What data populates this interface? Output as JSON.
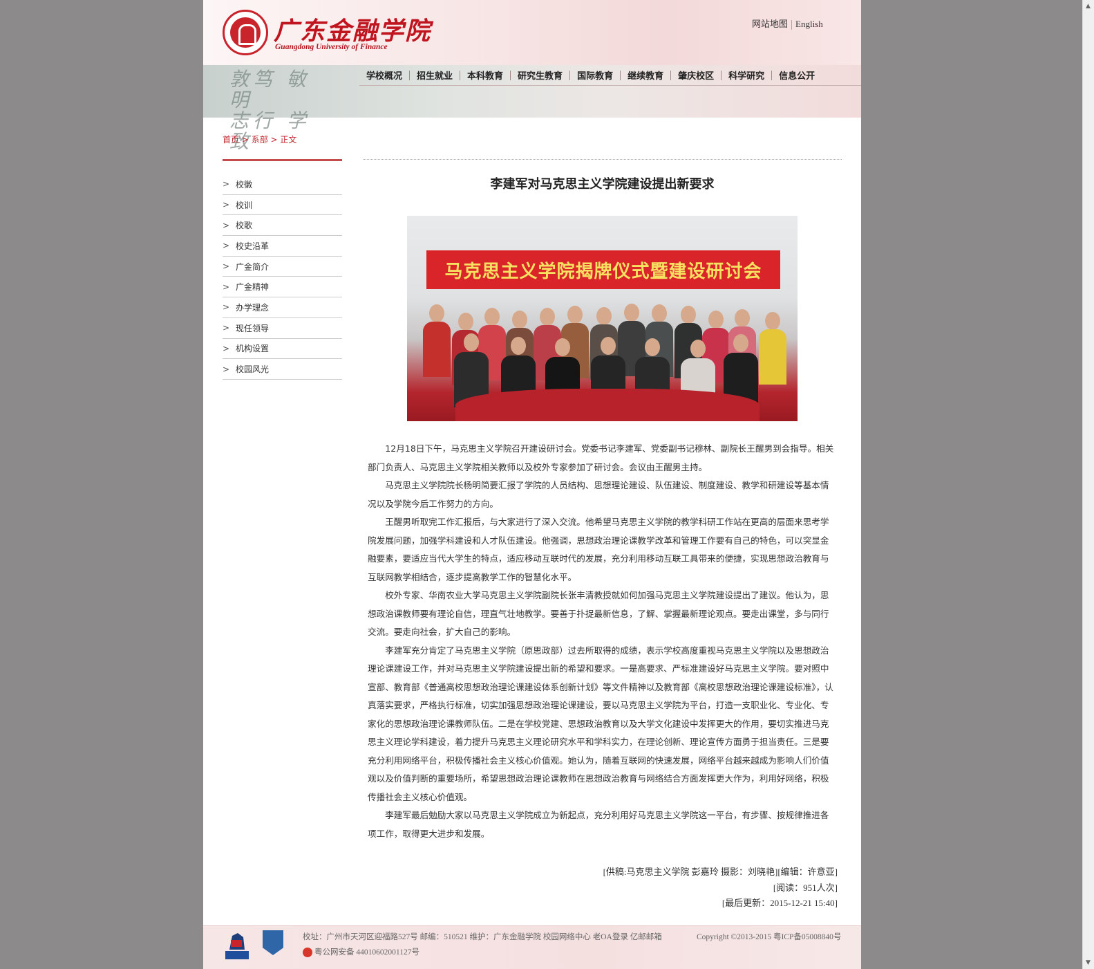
{
  "header": {
    "logo_cn": "广东金融学院",
    "logo_en": "Guangdong University of Finance",
    "sitemap": "网站地图",
    "english": "English"
  },
  "nav": [
    "学校概况",
    "招生就业",
    "本科教育",
    "研究生教育",
    "国际教育",
    "继续教育",
    "肇庆校区",
    "科学研究",
    "信息公开"
  ],
  "breadcrumb": {
    "home": "首页",
    "sep1": " > ",
    "section": "系部",
    "sep2": " > ",
    "current": "正文"
  },
  "sidebar": [
    "校徽",
    "校训",
    "校歌",
    "校史沿革",
    "广金简介",
    "广金精神",
    "办学理念",
    "现任领导",
    "机构设置",
    "校园风光"
  ],
  "article": {
    "title": "李建军对马克思主义学院建设提出新要求",
    "photo_banner": "马克思主义学院揭牌仪式暨建设研讨会",
    "paragraphs": [
      "12月18日下午，马克思主义学院召开建设研讨会。党委书记李建军、党委副书记穆林、副院长王醒男到会指导。相关部门负责人、马克思主义学院相关教师以及校外专家参加了研讨会。会议由王醒男主持。",
      "马克思主义学院院长杨明简要汇报了学院的人员结构、思想理论建设、队伍建设、制度建设、教学和研建设等基本情况以及学院今后工作努力的方向。",
      "王醒男听取完工作汇报后，与大家进行了深入交流。他希望马克思主义学院的教学科研工作站在更高的层面来思考学院发展问题，加强学科建设和人才队伍建设。他强调，思想政治理论课教学改革和管理工作要有自己的特色，可以突显金融要素，要适应当代大学生的特点，适应移动互联时代的发展，充分利用移动互联工具带来的便捷，实现思想政治教育与互联网教学相结合，逐步提高教学工作的智慧化水平。",
      "校外专家、华南农业大学马克思主义学院副院长张丰清教授就如何加强马克思主义学院建设提出了建议。他认为，思想政治课教师要有理论自信，理直气壮地教学。要善于扑捉最新信息，了解、掌握最新理论观点。要走出课堂，多与同行交流。要走向社会，扩大自己的影响。",
      "李建军充分肯定了马克思主义学院（原思政部）过去所取得的成绩，表示学校高度重视马克思主义学院以及思想政治理论课建设工作，并对马克思主义学院建设提出新的希望和要求。一是高要求、严标准建设好马克思主义学院。要对照中宣部、教育部《普通高校思想政治理论课建设体系创新计划》等文件精神以及教育部《高校思想政治理论课建设标准》，认真落实要求，严格执行标准，切实加强思想政治理论课建设，要以马克思主义学院为平台，打造一支职业化、专业化、专家化的思想政治理论课教师队伍。二是在学校党建、思想政治教育以及大学文化建设中发挥更大的作用，要切实推进马克思主义理论学科建设，着力提升马克思主义理论研究水平和学科实力，在理论创新、理论宣传方面勇于担当责任。三是要充分利用网络平台，积极传播社会主义核心价值观。她认为，随着互联网的快速发展，网络平台越来越成为影响人们价值观以及价值判断的重要场所，希望思想政治理论课教师在思想政治教育与网络结合方面发挥更大作为，利用好网络，积极传播社会主义核心价值观。",
      "李建军最后勉励大家以马克思主义学院成立为新起点，充分利用好马克思主义学院这一平台，有步骤、按规律推进各项工作，取得更大进步和发展。"
    ],
    "credit": "[供稿:马克思主义学院 彭嘉玲 摄影：刘晓艳][编辑：许意亚]",
    "reads": "[阅读：951人次]",
    "updated": "[最后更新：2015-12-21 15:40]"
  },
  "footer": {
    "line1": "校址：广州市天河区迎福路527号  邮编：510521  维护：广东金融学院  校园网络中心 老OA登录 亿邮邮箱",
    "line2": "粤公网安备  44010602001127号",
    "copyright": "Copyright ©2013-2015 粤ICP备05008840号"
  },
  "colors": {
    "accent": "#c0141f",
    "background": "#8c8a8a"
  }
}
